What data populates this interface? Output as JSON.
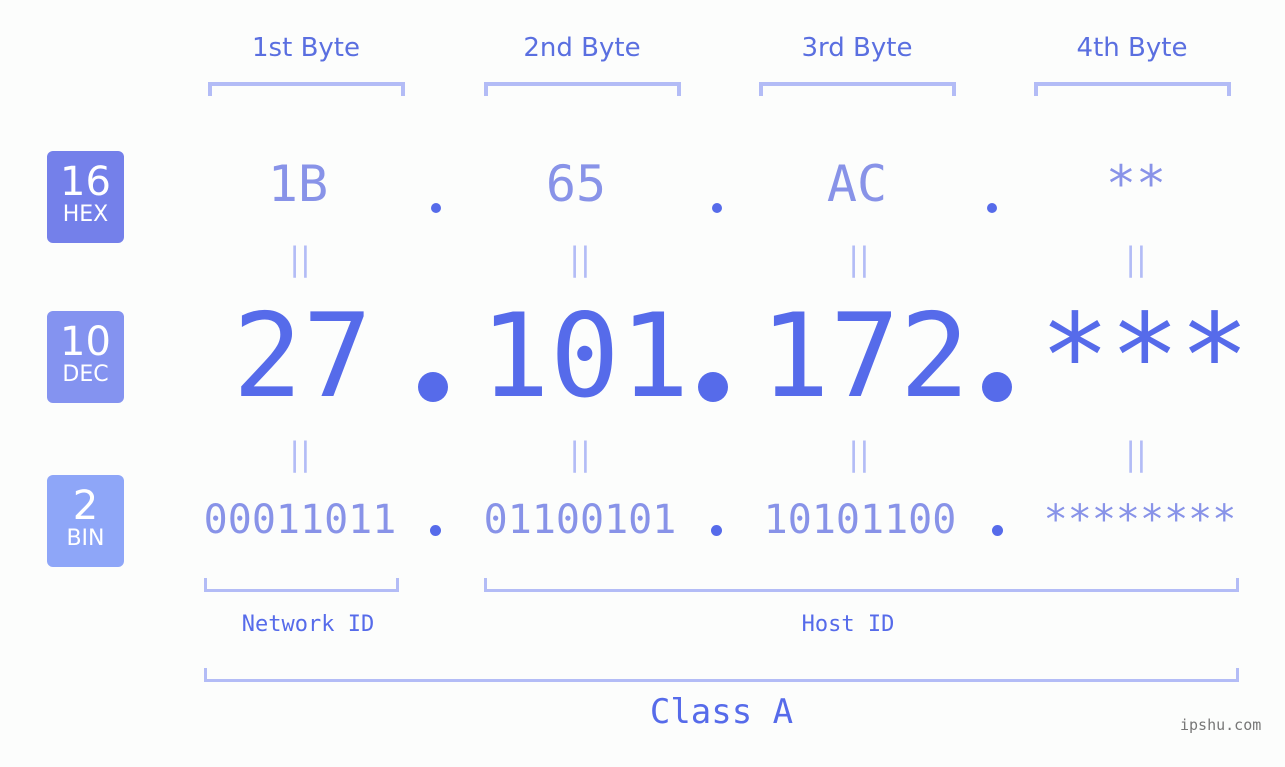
{
  "bytes": {
    "headers": [
      "1st Byte",
      "2nd Byte",
      "3rd Byte",
      "4th Byte"
    ]
  },
  "badges": {
    "hex": {
      "number": "16",
      "label": "HEX",
      "color": "#7480ea"
    },
    "dec": {
      "number": "10",
      "label": "DEC",
      "color": "#8493f0"
    },
    "bin": {
      "number": "2",
      "label": "BIN",
      "color": "#8ea6f8"
    }
  },
  "hex_values": [
    "1B",
    "65",
    "AC",
    "**"
  ],
  "dec_values": [
    "27",
    "101",
    "172",
    "***"
  ],
  "bin_values": [
    "00011011",
    "01100101",
    "10101100",
    "********"
  ],
  "separator": ".",
  "equals_symbol": "||",
  "segments": {
    "network_id": "Network ID",
    "host_id": "Host ID"
  },
  "ip_class": "Class A",
  "watermark": "ipshu.com",
  "colors": {
    "accent": "#566bea",
    "light_text": "#8893e8",
    "bracket": "#b3bcf6"
  }
}
